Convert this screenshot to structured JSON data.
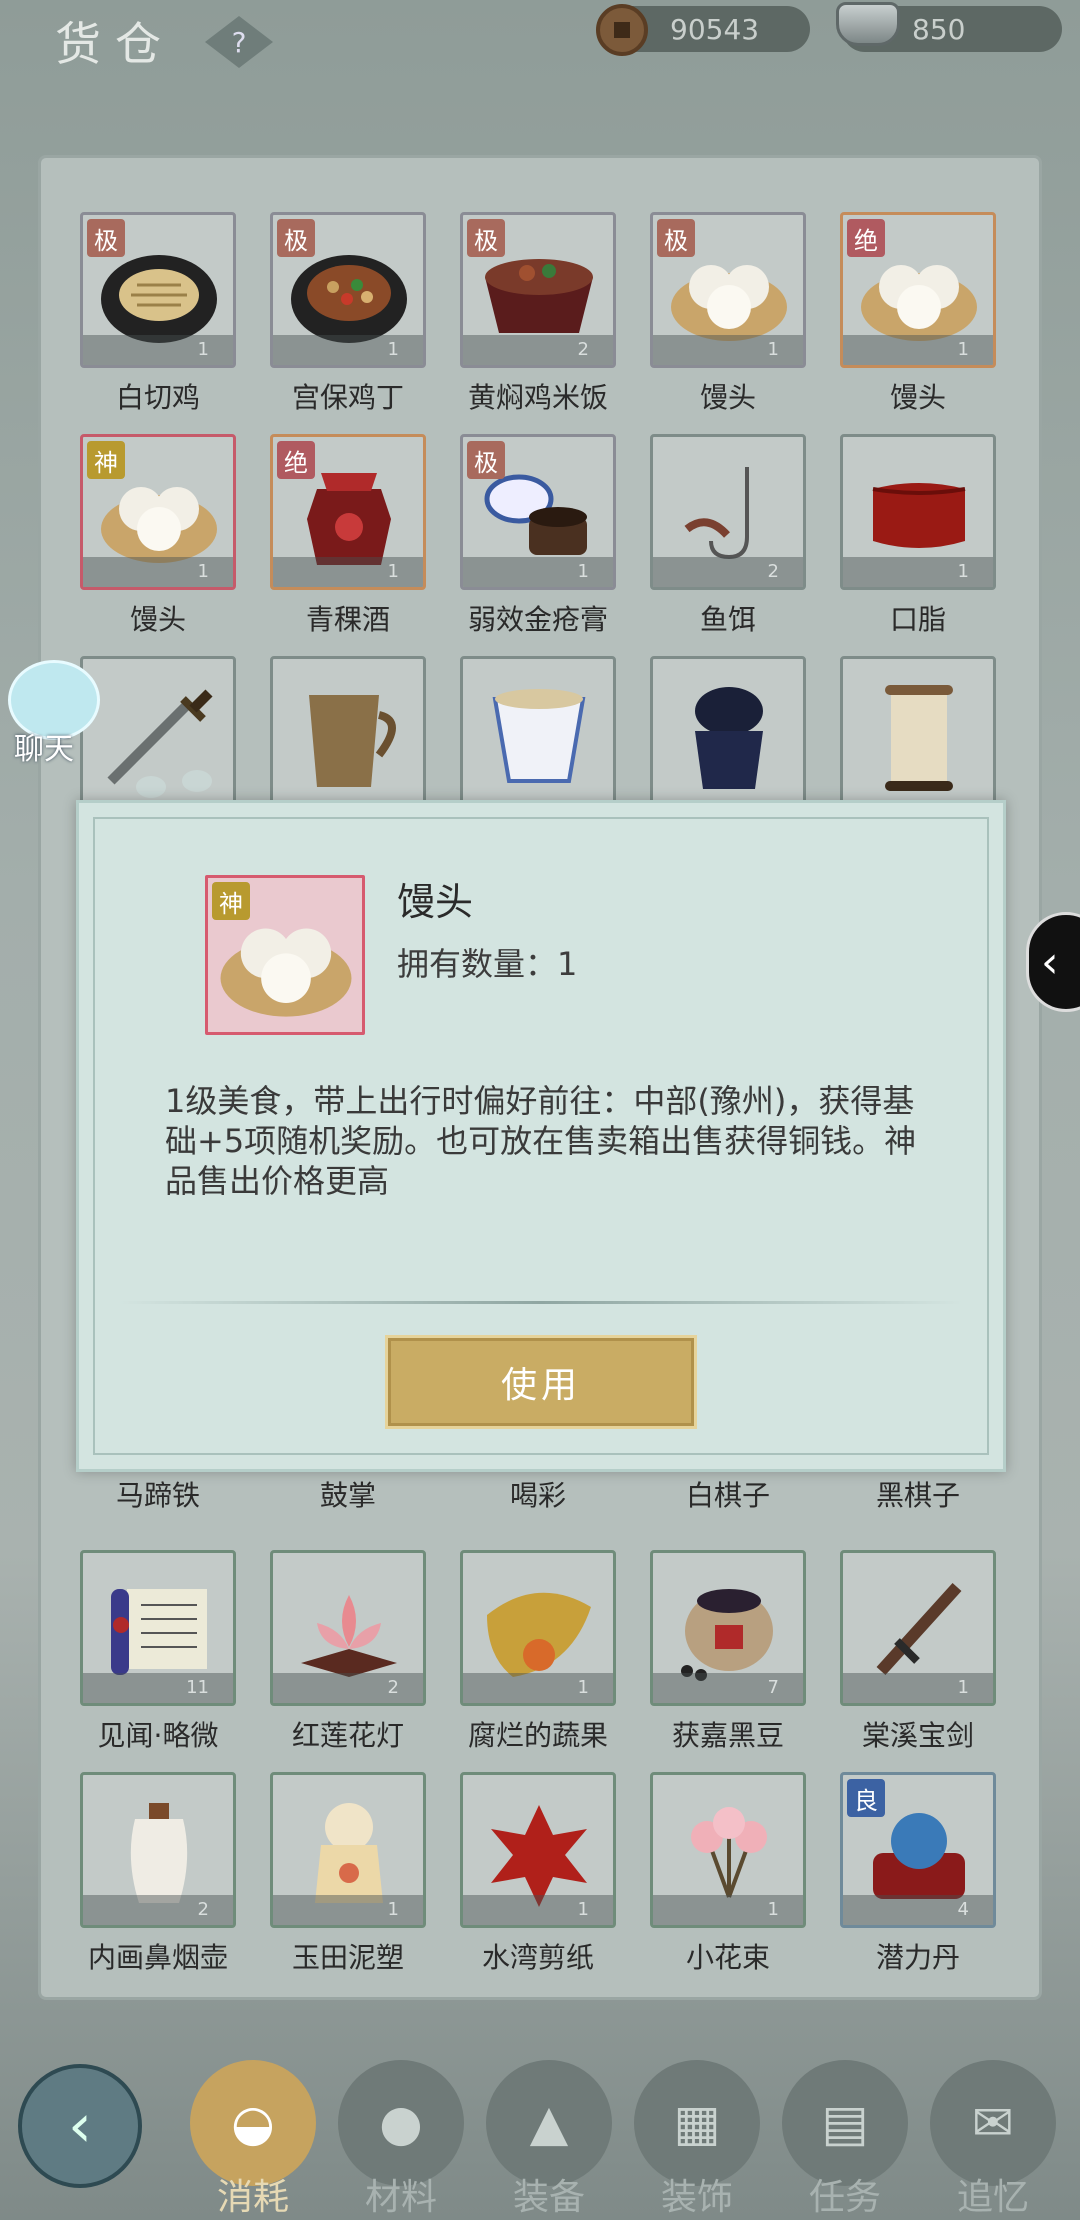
{
  "header": {
    "title": "货仓",
    "help": "?",
    "copper": "90543",
    "silver": "850"
  },
  "badges": {
    "ji": "极",
    "jue": "绝",
    "shen": "神",
    "liang": "良"
  },
  "grid": {
    "row1": [
      {
        "name": "白切鸡",
        "badge": "极",
        "count": "1"
      },
      {
        "name": "宫保鸡丁",
        "badge": "极",
        "count": "1"
      },
      {
        "name": "黄焖鸡米饭",
        "badge": "极",
        "count": "2"
      },
      {
        "name": "馒头",
        "badge": "极",
        "count": "1"
      },
      {
        "name": "馒头",
        "badge": "绝",
        "count": "1"
      }
    ],
    "row2": [
      {
        "name": "馒头",
        "badge": "神",
        "count": "1"
      },
      {
        "name": "青稞酒",
        "badge": "绝",
        "count": "1"
      },
      {
        "name": "弱效金疮膏",
        "badge": "极",
        "count": "1"
      },
      {
        "name": "鱼饵",
        "badge": "",
        "count": "2"
      },
      {
        "name": "口脂",
        "badge": "",
        "count": "1"
      }
    ],
    "row4_names": [
      "马蹄铁",
      "鼓掌",
      "喝彩",
      "白棋子",
      "黑棋子"
    ],
    "row5": [
      {
        "name": "见闻·略微",
        "count": "11"
      },
      {
        "name": "红莲花灯",
        "count": "2"
      },
      {
        "name": "腐烂的蔬果",
        "count": "1"
      },
      {
        "name": "获嘉黑豆",
        "count": "7"
      },
      {
        "name": "棠溪宝剑",
        "count": "1"
      }
    ],
    "row6": [
      {
        "name": "内画鼻烟壶",
        "count": "2"
      },
      {
        "name": "玉田泥塑",
        "count": "1"
      },
      {
        "name": "水湾剪纸",
        "count": "1"
      },
      {
        "name": "小花束",
        "count": "1"
      },
      {
        "name": "潜力丹",
        "badge": "良",
        "count": "4"
      }
    ]
  },
  "chat": {
    "label": "聊天"
  },
  "dialog": {
    "item_name": "馒头",
    "badge": "神",
    "owned": "拥有数量：1",
    "description": "1级美食，带上出行时偏好前往：中部(豫州)，获得基础+5项随机奖励。也可放在售卖箱出售获得铜钱。神品售出价格更高",
    "use_button": "使用"
  },
  "tabs": [
    "消耗",
    "材料",
    "装备",
    "装饰",
    "任务",
    "追忆"
  ],
  "active_tab": "消耗"
}
